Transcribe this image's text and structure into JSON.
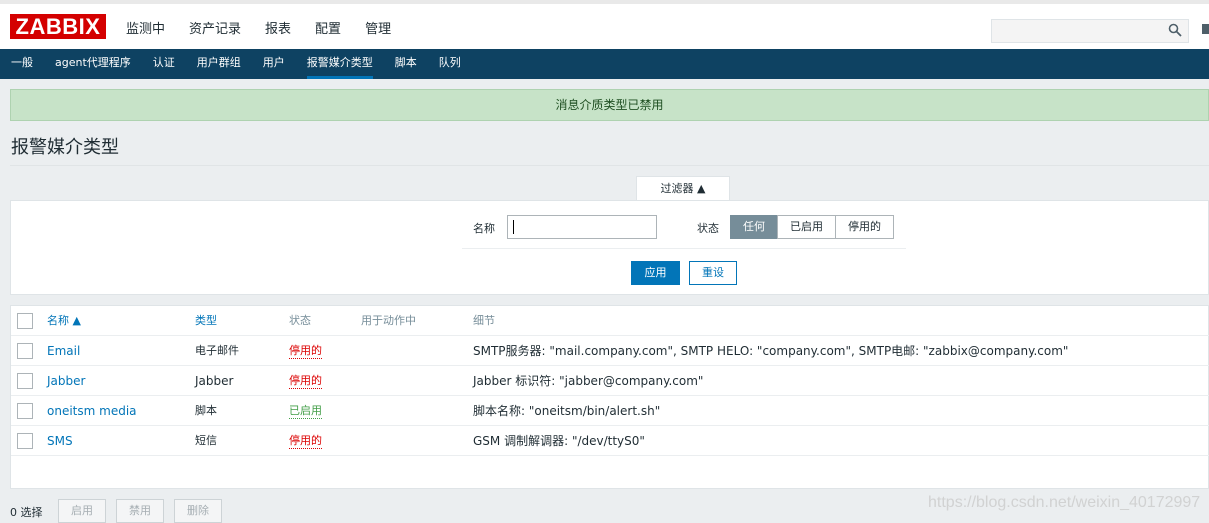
{
  "header": {
    "logo": "ZABBIX",
    "nav": [
      "监测中",
      "资产记录",
      "报表",
      "配置",
      "管理"
    ]
  },
  "subnav": {
    "items": [
      "一般",
      "agent代理程序",
      "认证",
      "用户群组",
      "用户",
      "报警媒介类型",
      "脚本",
      "队列"
    ],
    "active": "报警媒介类型"
  },
  "message": "消息介质类型已禁用",
  "page": {
    "title": "报警媒介类型"
  },
  "filter": {
    "tab_label": "过滤器 ▲",
    "name_label": "名称",
    "name_value": "",
    "status_label": "状态",
    "status_options": [
      "任何",
      "已启用",
      "停用的"
    ],
    "status_selected": "任何",
    "apply_label": "应用",
    "reset_label": "重设"
  },
  "table": {
    "headers": {
      "name": "名称 ▲",
      "type": "类型",
      "status": "状态",
      "used": "用于动作中",
      "details": "细节"
    },
    "rows": [
      {
        "name": "Email",
        "type": "电子邮件",
        "status": "停用的",
        "details": "SMTP服务器: \"mail.company.com\", SMTP HELO: \"company.com\", SMTP电邮: \"zabbix@company.com\""
      },
      {
        "name": "Jabber",
        "type": "Jabber",
        "status": "停用的",
        "details": "Jabber 标识符: \"jabber@company.com\""
      },
      {
        "name": "oneitsm media",
        "type": "脚本",
        "status": "已启用",
        "details": "脚本名称: \"oneitsm/bin/alert.sh\""
      },
      {
        "name": "SMS",
        "type": "短信",
        "status": "停用的",
        "details": "GSM 调制解调器: \"/dev/ttyS0\""
      }
    ]
  },
  "footer": {
    "selected": "0 选择",
    "buttons": [
      "启用",
      "禁用",
      "删除"
    ]
  },
  "watermark": "https://blog.csdn.net/weixin_40172997",
  "colors": {
    "brand": "#d40000",
    "subnav_bg": "#0e4262",
    "accent": "#0275b8",
    "disabled": "#dc0000",
    "enabled": "#429e47",
    "message_bg": "#c7e3c8"
  }
}
